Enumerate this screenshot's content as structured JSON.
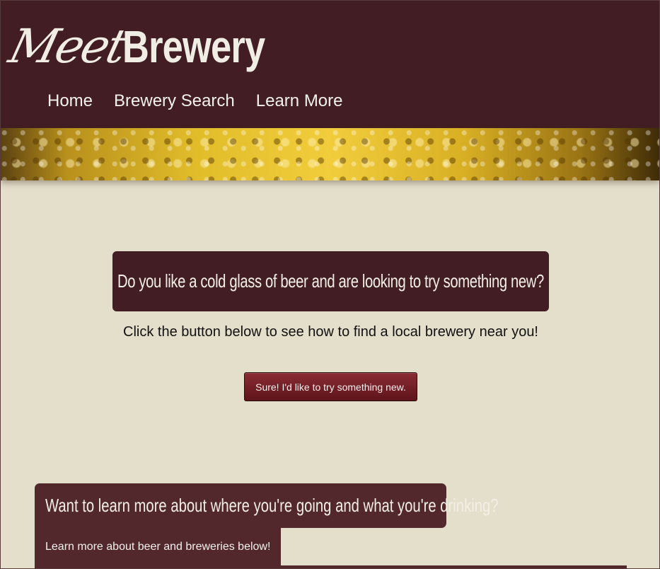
{
  "header": {
    "logo_script": "Meet",
    "logo_bold": "Brewery",
    "nav": [
      {
        "label": "Home"
      },
      {
        "label": "Brewery Search"
      },
      {
        "label": "Learn More"
      }
    ]
  },
  "banner": {
    "icon": "beer-bubbles-image"
  },
  "hero": {
    "title": "Do you like a cold glass of beer and are looking to try something new?",
    "subtitle": "Click the button below to see how to find a local brewery near you!",
    "cta_label": "Sure! I'd like to try something new."
  },
  "learn": {
    "title": "Want to learn more about where you're going and what you're drinking?",
    "tab_label": "Learn more about beer and breweries below!"
  },
  "colors": {
    "header_bg": "#421e24",
    "page_bg": "#e3dfcb",
    "button_bg": "#6e1e25",
    "learn_bg": "#52282c"
  }
}
